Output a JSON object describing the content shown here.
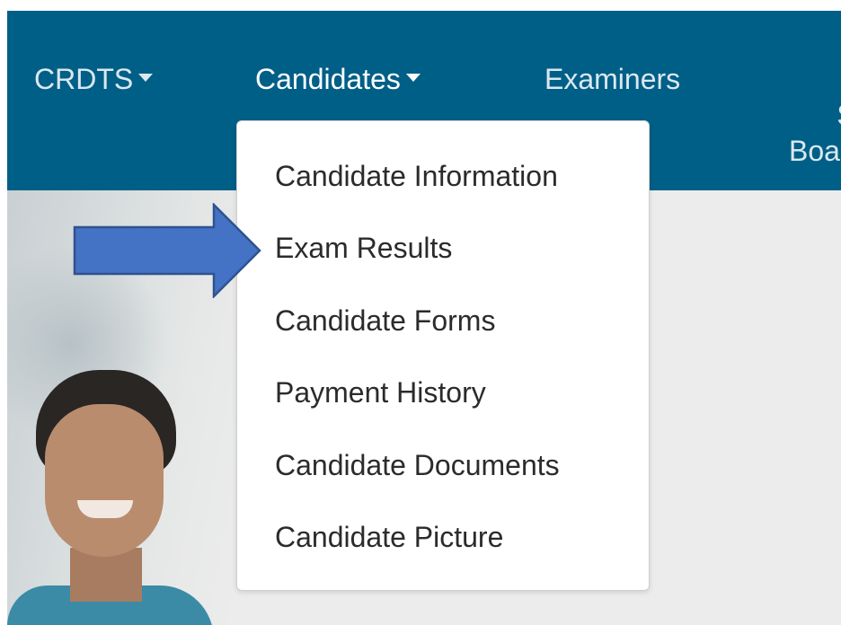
{
  "navbar": {
    "items": [
      {
        "label": "CRDTS",
        "has_caret": true,
        "active": false
      },
      {
        "label": "Candidates",
        "has_caret": true,
        "active": true
      },
      {
        "label": "Examiners",
        "has_caret": false,
        "active": false
      },
      {
        "label": "State\nBoard",
        "has_caret": false,
        "active": false
      }
    ]
  },
  "dropdown": {
    "items": [
      {
        "label": "Candidate Information"
      },
      {
        "label": "Exam Results"
      },
      {
        "label": "Candidate Forms"
      },
      {
        "label": "Payment History"
      },
      {
        "label": "Candidate Documents"
      },
      {
        "label": "Candidate Picture"
      }
    ]
  },
  "annotation": {
    "arrow_target": "Exam Results",
    "arrow_color": "#4472c4",
    "arrow_outline": "#2f528f"
  },
  "colors": {
    "navbar_bg": "#005f87",
    "nav_text": "#dbe8f0",
    "nav_text_active": "#ffffff",
    "dropdown_text": "#2b2b2b",
    "page_bg": "#ececec"
  }
}
